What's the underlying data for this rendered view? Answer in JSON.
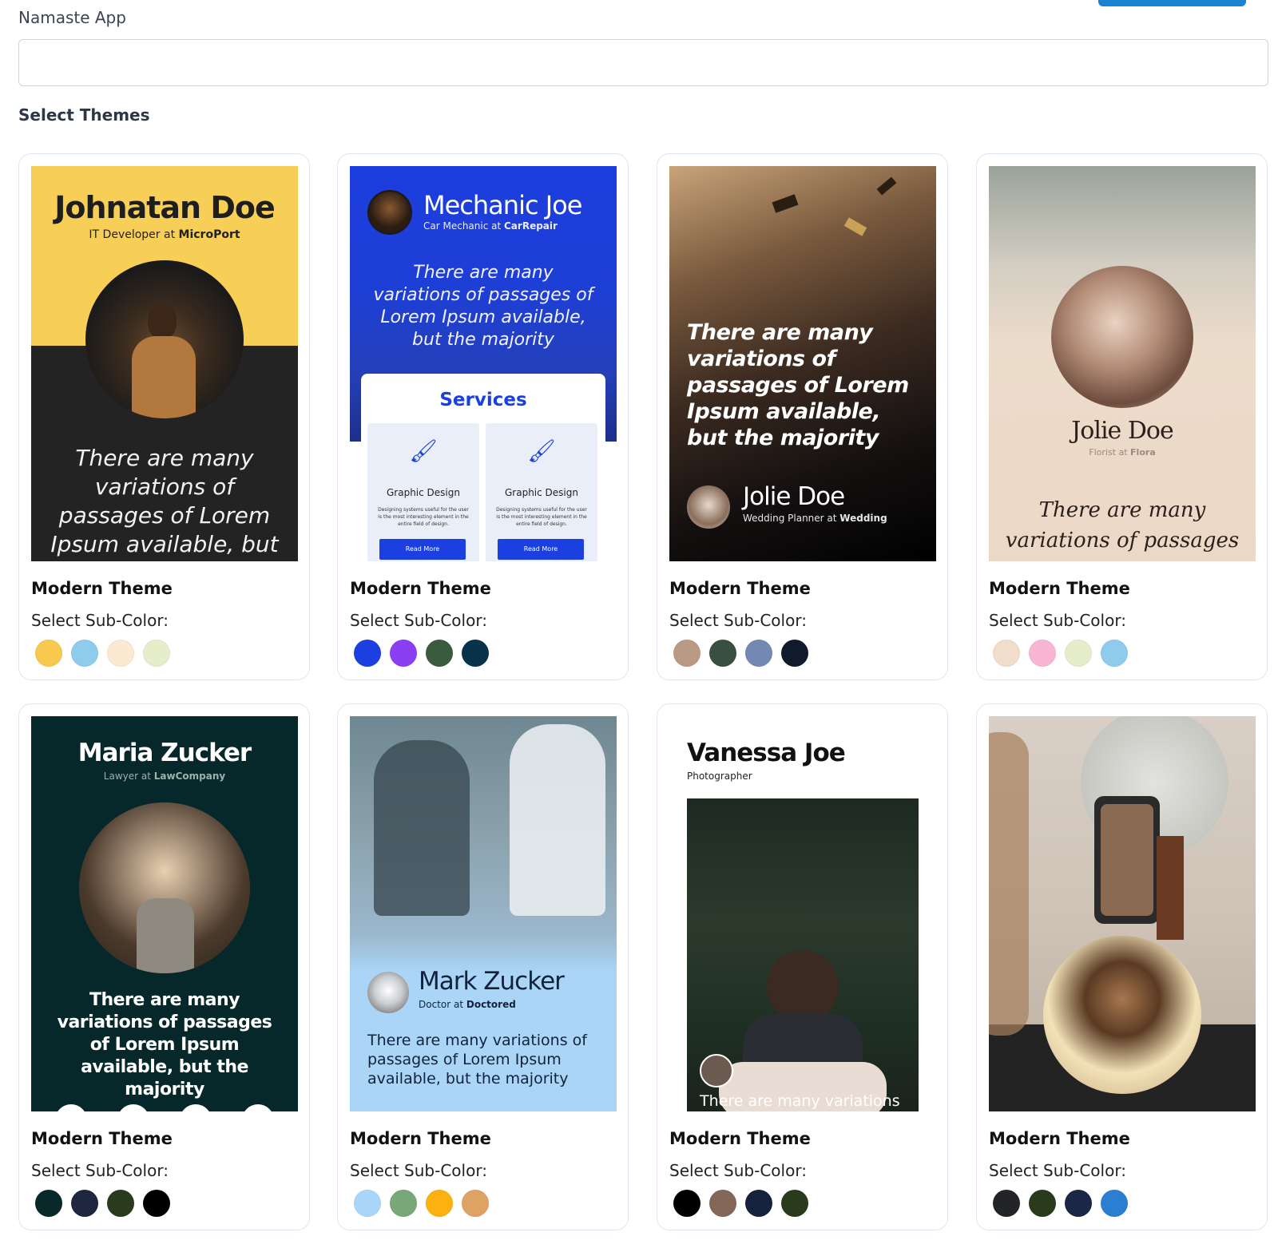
{
  "app": {
    "name_label": "Namaste App",
    "name_value": ""
  },
  "section": {
    "title": "Select Themes"
  },
  "cards": [
    {
      "title": "Modern Theme",
      "sub_label": "Select Sub-Color:",
      "colors": [
        "#f8c94f",
        "#8fcbec",
        "#fbe9d2",
        "#e6edcb"
      ],
      "preview": {
        "name": "Johnatan Doe",
        "role": "IT Developer at ",
        "company": "MicroPort",
        "quote": "There are many variations of passages of Lorem Ipsum available, but the"
      }
    },
    {
      "title": "Modern Theme",
      "sub_label": "Select Sub-Color:",
      "colors": [
        "#1b3fe0",
        "#8a3ff2",
        "#3b5b3f",
        "#07324a"
      ],
      "preview": {
        "name": "Mechanic Joe",
        "role": "Car Mechanic at ",
        "company": "CarRepair",
        "quote": "There are many variations of passages of Lorem Ipsum available, but the majority",
        "services_title": "Services",
        "service_name": "Graphic Design",
        "service_desc": "Designing systems useful for the user is the most interesting element in the entire field of design.",
        "service_btn": "Read More"
      }
    },
    {
      "title": "Modern Theme",
      "sub_label": "Select Sub-Color:",
      "colors": [
        "#bb9a85",
        "#37503f",
        "#7389b4",
        "#101a2b"
      ],
      "preview": {
        "name": "Jolie Doe",
        "role": "Wedding Planner at ",
        "company": "Wedding",
        "quote": "There are many variations of passages of Lorem Ipsum available, but the majority"
      }
    },
    {
      "title": "Modern Theme",
      "sub_label": "Select Sub-Color:",
      "colors": [
        "#f0ddcb",
        "#f9b6d4",
        "#e6edcb",
        "#8fcbec"
      ],
      "preview": {
        "name": "Jolie Doe",
        "role": "Florist at ",
        "company": "Flora",
        "quote": "There are many variations of passages of Lorem Ipsum available"
      }
    },
    {
      "title": "Modern Theme",
      "sub_label": "Select Sub-Color:",
      "colors": [
        "#08282a",
        "#1e2640",
        "#2a3a1d",
        "#000000"
      ],
      "preview": {
        "name": "Maria Zucker",
        "role": "Lawyer at ",
        "company": "LawCompany",
        "quote": "There are many variations of passages of Lorem Ipsum available, but the majority"
      }
    },
    {
      "title": "Modern Theme",
      "sub_label": "Select Sub-Color:",
      "colors": [
        "#a9d6f8",
        "#78a878",
        "#fbb10f",
        "#dea262"
      ],
      "preview": {
        "name": "Mark Zucker",
        "role": "Doctor at ",
        "company": "Doctored",
        "quote": "There are many variations of passages of Lorem Ipsum available, but the majority"
      }
    },
    {
      "title": "Modern Theme",
      "sub_label": "Select Sub-Color:",
      "colors": [
        "#000000",
        "#85675a",
        "#15213d",
        "#2a3a1d"
      ],
      "preview": {
        "name": "Vanessa Joe",
        "role": "Photographer",
        "quote": "There are many variations"
      }
    },
    {
      "title": "Modern Theme",
      "sub_label": "Select Sub-Color:",
      "colors": [
        "#222427",
        "#2a3a1d",
        "#1a2746",
        "#2a7fd2"
      ],
      "preview": {}
    }
  ]
}
